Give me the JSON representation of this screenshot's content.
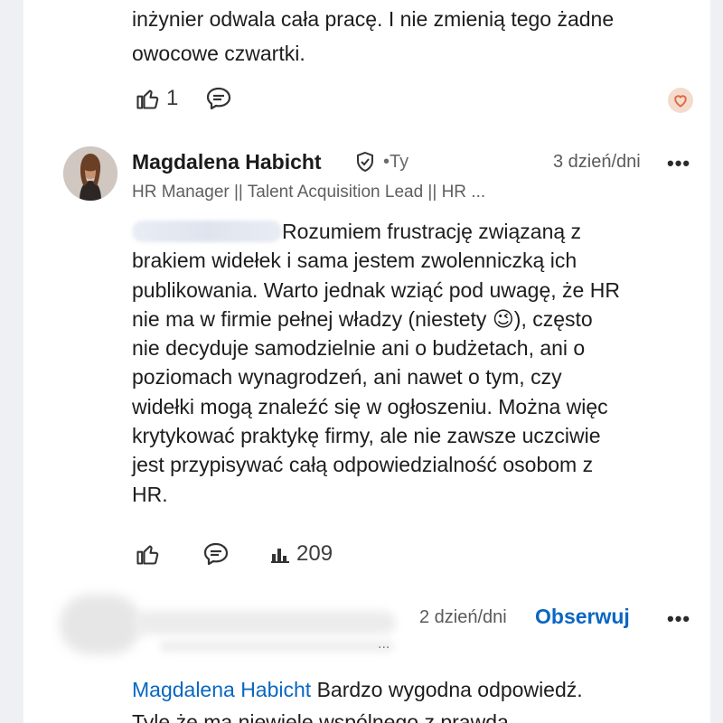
{
  "previous_comment": {
    "text_line1": "inżynier odwala cała pracę. I nie zmienią tego żadne",
    "text_line2": "owocowe czwartki.",
    "reaction_count": "1"
  },
  "comment": {
    "author": "Magdalena Habicht",
    "you_label": "•Ty",
    "time": "3 dzień/dni",
    "more_label": "•••",
    "headline": "HR Manager || Talent Acquisition Lead || HR ...",
    "text_first": "Rozumiem frustrację związaną z",
    "lines": [
      "brakiem widełek i sama jestem zwolenniczką ich",
      "publikowania. Warto jednak wziąć pod uwagę, że HR",
      "nie ma w firmie pełnej władzy (niestety 😉), często",
      "nie decyduje samodzielnie ani o budżetach, ani o",
      "poziomach wynagrodzeń, ani nawet o tym, czy",
      "widełki mogą znaleźć się w ogłoszeniu. Można więc",
      "krytykować praktykę firmy, ale nie zawsze uczciwie",
      "jest przypisywać całą odpowiedzialność osobom z",
      "HR."
    ],
    "impressions": "209"
  },
  "reply": {
    "time": "2 dzień/dni",
    "follow_label": "Obserwuj",
    "more_label": "•••",
    "headline_ellipsis": "...",
    "mention": "Magdalena Habicht",
    "text_line1": " Bardzo wygodna odpowiedź.",
    "text_line2": "Tyle że ma niewiele wspólnego z prawdą."
  },
  "colors": {
    "link": "#0a66c2",
    "heart_bg": "#f3dccd",
    "heart": "#e16745"
  },
  "icons": [
    "like-icon",
    "comment-icon",
    "heart-reaction-icon",
    "verified-shield-icon",
    "impressions-icon",
    "more-icon"
  ]
}
